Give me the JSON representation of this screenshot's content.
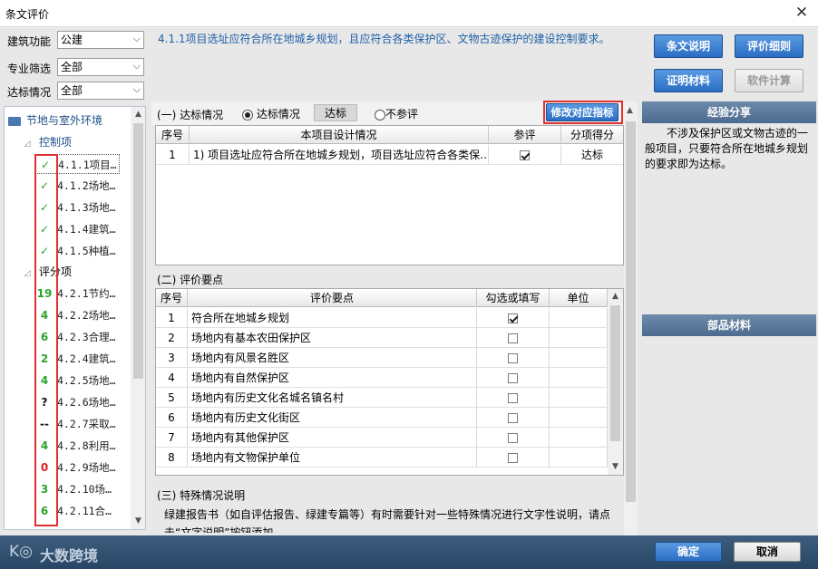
{
  "window": {
    "title": "条文评价",
    "close": "✕"
  },
  "filters": [
    {
      "label": "建筑功能",
      "value": "公建"
    },
    {
      "label": "专业筛选",
      "value": "全部"
    },
    {
      "label": "达标情况",
      "value": "全部"
    }
  ],
  "tree": {
    "root": "节地与室外环境",
    "group1": "控制项",
    "group2": "评分项",
    "items": [
      {
        "mark": "✓",
        "code": "4.1.1项目…",
        "status": "green"
      },
      {
        "mark": "✓",
        "code": "4.1.2场地…",
        "status": "green"
      },
      {
        "mark": "✓",
        "code": "4.1.3场地…",
        "status": "green"
      },
      {
        "mark": "✓",
        "code": "4.1.4建筑…",
        "status": "green"
      },
      {
        "mark": "✓",
        "code": "4.1.5种植…",
        "status": "green"
      },
      {
        "mark": "19",
        "code": "4.2.1节约…",
        "status": "green"
      },
      {
        "mark": "4",
        "code": "4.2.2场地…",
        "status": "green"
      },
      {
        "mark": "6",
        "code": "4.2.3合理…",
        "status": "green"
      },
      {
        "mark": "2",
        "code": "4.2.4建筑…",
        "status": "green"
      },
      {
        "mark": "4",
        "code": "4.2.5场地…",
        "status": "green"
      },
      {
        "mark": "?",
        "code": "4.2.6场地…",
        "status": "black"
      },
      {
        "mark": "--",
        "code": "4.2.7采取…",
        "status": "black"
      },
      {
        "mark": "4",
        "code": "4.2.8利用…",
        "status": "green"
      },
      {
        "mark": "0",
        "code": "4.2.9场地…",
        "status": "red"
      },
      {
        "mark": "3",
        "code": "4.2.10场…",
        "status": "green"
      },
      {
        "mark": "6",
        "code": "4.2.11合…",
        "status": "green"
      }
    ]
  },
  "description": "4.1.1项目选址应符合所在地城乡规划，且应符合各类保护区、文物古迹保护的建设控制要求。",
  "section1": {
    "title": "(一) 达标情况",
    "radio1": "达标情况",
    "badge": "达标",
    "radio2": "不参评",
    "modify_button": "修改对应指标",
    "headers": [
      "序号",
      "本项目设计情况",
      "参评",
      "分项得分"
    ],
    "rows": [
      {
        "no": "1",
        "text": "1) 项目选址应符合所在地城乡规划，项目选址应符合各类保…",
        "checked": true,
        "score": "达标"
      }
    ]
  },
  "section2": {
    "title": "(二) 评价要点",
    "headers": [
      "序号",
      "评价要点",
      "勾选或填写",
      "单位"
    ],
    "rows": [
      {
        "no": "1",
        "text": "符合所在地城乡规划",
        "checked": true
      },
      {
        "no": "2",
        "text": "场地内有基本农田保护区",
        "checked": false
      },
      {
        "no": "3",
        "text": "场地内有风景名胜区",
        "checked": false
      },
      {
        "no": "4",
        "text": "场地内有自然保护区",
        "checked": false
      },
      {
        "no": "5",
        "text": "场地内有历史文化名城名镇名村",
        "checked": false
      },
      {
        "no": "6",
        "text": "场地内有历史文化街区",
        "checked": false
      },
      {
        "no": "7",
        "text": "场地内有其他保护区",
        "checked": false
      },
      {
        "no": "8",
        "text": "场地内有文物保护单位",
        "checked": false
      }
    ]
  },
  "section3": {
    "title": "(三) 特殊情况说明",
    "text": "绿建报告书（如自评估报告、绿建专篇等）有时需要针对一些特殊情况进行文字性说明，请点击“文字说明”按钮添加。"
  },
  "right": {
    "buttons": [
      "条文说明",
      "评价细则",
      "证明材料"
    ],
    "disabled_button": "软件计算",
    "experience_title": "经验分享",
    "experience_text": "不涉及保护区或文物古迹的一般项目，只要符合所在地城乡规划的要求即为达标。",
    "parts_title": "部品材料"
  },
  "footer": {
    "watermark": "大数跨境",
    "confirm": "确定",
    "cancel": "取消"
  },
  "colors": {
    "accent": "#2a6ec4",
    "pass": "#2aa52a",
    "fail": "#e02020",
    "highlight": "#e23030"
  }
}
